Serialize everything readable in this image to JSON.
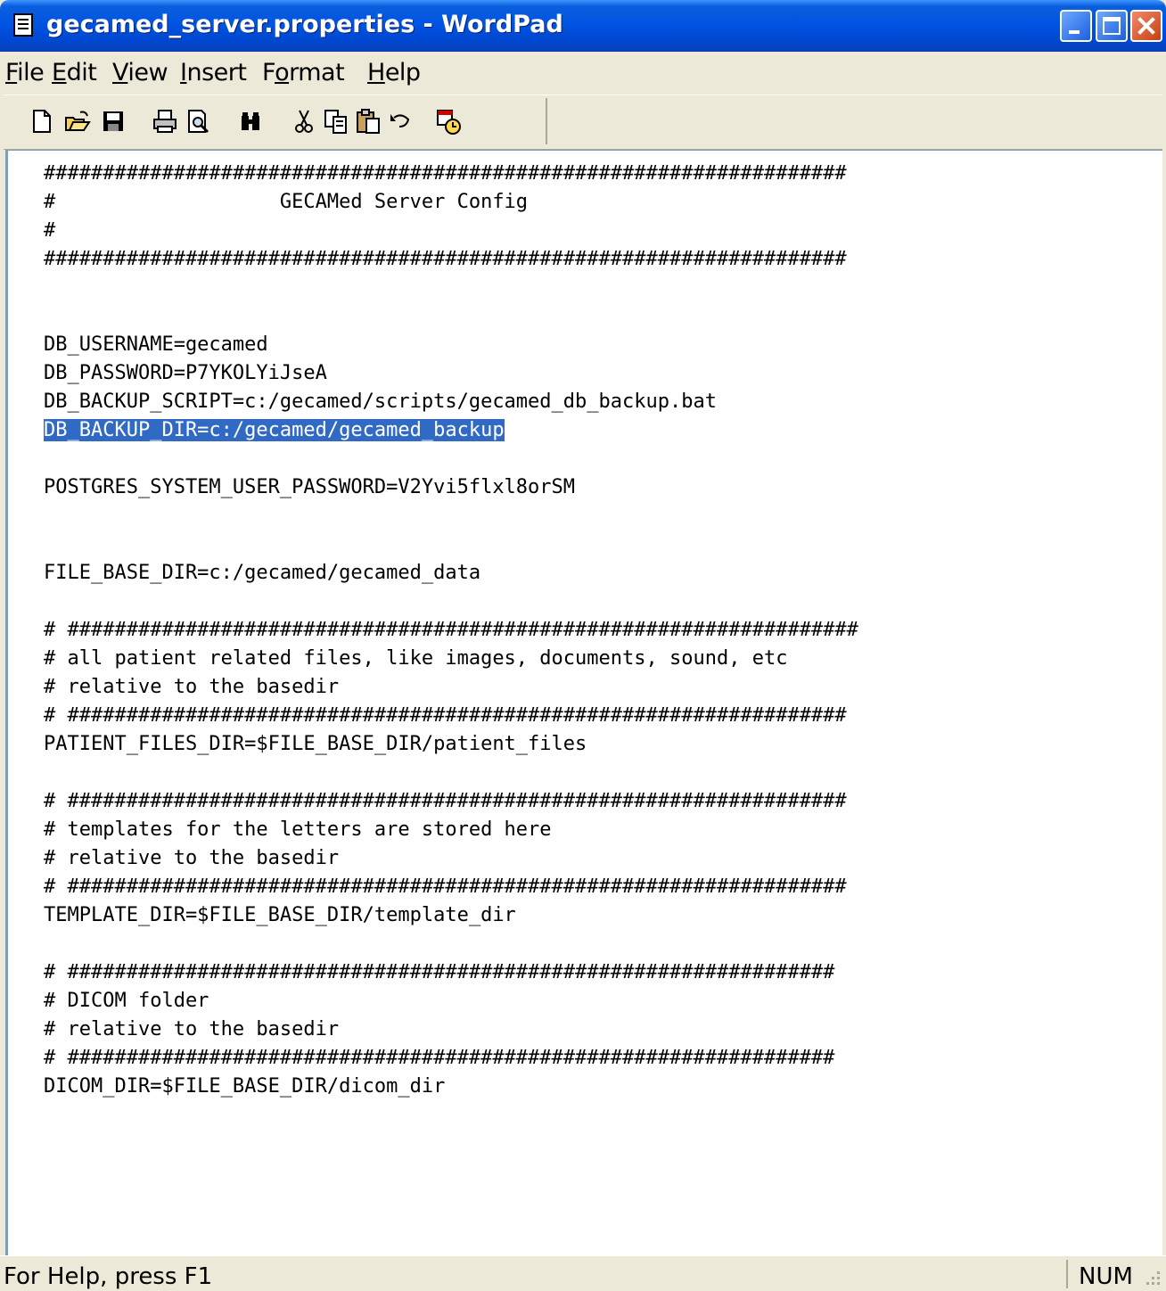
{
  "window": {
    "title": "gecamed_server.properties - WordPad",
    "controls": {
      "minimize": "minimize",
      "maximize": "maximize",
      "close": "close"
    }
  },
  "menu": [
    {
      "label": "File",
      "underline": "F"
    },
    {
      "label": "Edit",
      "underline": "E"
    },
    {
      "label": "View",
      "underline": "V"
    },
    {
      "label": "Insert",
      "underline": "I"
    },
    {
      "label": "Format",
      "underline": "o"
    },
    {
      "label": "Help",
      "underline": "H"
    }
  ],
  "toolbar": [
    {
      "name": "new-document-icon",
      "tooltip": "New"
    },
    {
      "name": "open-folder-icon",
      "tooltip": "Open"
    },
    {
      "name": "save-disk-icon",
      "tooltip": "Save"
    },
    {
      "name": "print-icon",
      "tooltip": "Print"
    },
    {
      "name": "print-preview-icon",
      "tooltip": "Print Preview"
    },
    {
      "name": "find-binoculars-icon",
      "tooltip": "Find"
    },
    {
      "name": "cut-scissors-icon",
      "tooltip": "Cut"
    },
    {
      "name": "copy-icon",
      "tooltip": "Copy"
    },
    {
      "name": "paste-icon",
      "tooltip": "Paste"
    },
    {
      "name": "undo-icon",
      "tooltip": "Undo"
    },
    {
      "name": "insert-datetime-icon",
      "tooltip": "Date/Time"
    }
  ],
  "document": {
    "selected_line": 10,
    "lines": [
      "####################################################################",
      "#                   GECAMed Server Config",
      "#",
      "####################################################################",
      "",
      "",
      "DB_USERNAME=gecamed",
      "DB_PASSWORD=P7YKOLYiJseA",
      "DB_BACKUP_SCRIPT=c:/gecamed/scripts/gecamed_db_backup.bat",
      "DB_BACKUP_DIR=c:/gecamed/gecamed_backup",
      "",
      "POSTGRES_SYSTEM_USER_PASSWORD=V2Yvi5flxl8orSM",
      "",
      "",
      "FILE_BASE_DIR=c:/gecamed/gecamed_data",
      "",
      "# ###################################################################",
      "# all patient related files, like images, documents, sound, etc",
      "# relative to the basedir",
      "# ##################################################################",
      "PATIENT_FILES_DIR=$FILE_BASE_DIR/patient_files",
      "",
      "# ##################################################################",
      "# templates for the letters are stored here",
      "# relative to the basedir",
      "# ##################################################################",
      "TEMPLATE_DIR=$FILE_BASE_DIR/template_dir",
      "",
      "# #################################################################",
      "# DICOM folder",
      "# relative to the basedir",
      "# #################################################################",
      "DICOM_DIR=$FILE_BASE_DIR/dicom_dir"
    ]
  },
  "status": {
    "help_text": "For Help, press F1",
    "num_lock": "NUM"
  }
}
